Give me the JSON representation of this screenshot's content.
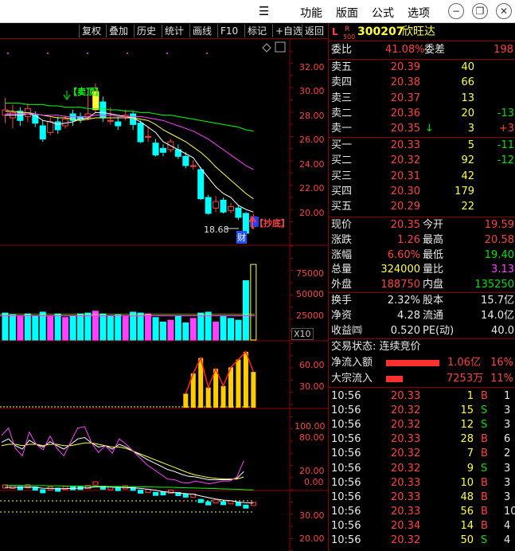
{
  "titlebar": {
    "menu_icon": "hamburger-menu-icon",
    "menus": [
      "功能",
      "版面",
      "公式",
      "选项"
    ],
    "buttons": [
      "minimize-icon",
      "restore-icon",
      "close-icon"
    ]
  },
  "toolbar": {
    "items": [
      "复权",
      "叠加",
      "历史",
      "统计",
      "画线",
      "F10",
      "标记",
      "+自选",
      "返回"
    ]
  },
  "main_chart": {
    "y_ticks": [
      "32.00",
      "30.00",
      "28.00",
      "26.00",
      "24.00",
      "22.00",
      "20.00"
    ],
    "sell_top_label": "【卖顶】",
    "buy_bottom_label": "【抄底】",
    "low_label": "18.68",
    "cai_label": "财"
  },
  "volume_chart": {
    "y_ticks": [
      "75000",
      "50000",
      "25000"
    ],
    "unit": "X10"
  },
  "indicator1": {
    "y_ticks": [
      "60.00",
      "30.00"
    ]
  },
  "indicator2": {
    "y_ticks": [
      "100.00",
      "80.00",
      "20.00",
      "0.00"
    ]
  },
  "indicator3": {
    "y_ticks": [
      "30.00",
      "20.00"
    ]
  },
  "chart_data": [
    {
      "type": "candlestick",
      "title": "",
      "ylim": [
        18.5,
        33.5
      ],
      "candles": [
        {
          "o": 28.0,
          "c": 28.4,
          "h": 29.3,
          "l": 27.4
        },
        {
          "o": 27.8,
          "c": 28.2,
          "h": 28.8,
          "l": 27.0
        },
        {
          "o": 28.3,
          "c": 27.6,
          "h": 28.6,
          "l": 27.2
        },
        {
          "o": 27.9,
          "c": 28.5,
          "h": 28.9,
          "l": 27.5
        },
        {
          "o": 28.0,
          "c": 27.4,
          "h": 28.3,
          "l": 27.1
        },
        {
          "o": 27.2,
          "c": 26.2,
          "h": 27.6,
          "l": 26.0
        },
        {
          "o": 26.7,
          "c": 27.5,
          "h": 27.8,
          "l": 26.5
        },
        {
          "o": 27.5,
          "c": 26.9,
          "h": 27.9,
          "l": 26.6
        },
        {
          "o": 27.2,
          "c": 27.7,
          "h": 28.0,
          "l": 27.0
        },
        {
          "o": 28.1,
          "c": 27.6,
          "h": 28.4,
          "l": 27.2
        },
        {
          "o": 27.9,
          "c": 27.7,
          "h": 28.2,
          "l": 27.4
        },
        {
          "o": 27.8,
          "c": 28.1,
          "h": 29.5,
          "l": 27.6
        },
        {
          "o": 28.4,
          "c": 29.8,
          "h": 30.4,
          "l": 28.2
        },
        {
          "o": 29.0,
          "c": 27.8,
          "h": 29.4,
          "l": 27.5
        },
        {
          "o": 27.6,
          "c": 27.6,
          "h": 28.6,
          "l": 27.3
        },
        {
          "o": 27.5,
          "c": 27.2,
          "h": 27.9,
          "l": 26.9
        },
        {
          "o": 27.9,
          "c": 28.0,
          "h": 28.4,
          "l": 27.6
        },
        {
          "o": 28.1,
          "c": 27.3,
          "h": 28.3,
          "l": 26.9
        },
        {
          "o": 27.4,
          "c": 26.0,
          "h": 27.6,
          "l": 25.9
        },
        {
          "o": 26.4,
          "c": 26.4,
          "h": 27.1,
          "l": 26.0
        },
        {
          "o": 25.9,
          "c": 25.0,
          "h": 26.2,
          "l": 24.9
        },
        {
          "o": 25.5,
          "c": 25.2,
          "h": 25.8,
          "l": 24.9
        },
        {
          "o": 25.4,
          "c": 26.0,
          "h": 26.2,
          "l": 25.2
        },
        {
          "o": 25.4,
          "c": 24.9,
          "h": 25.8,
          "l": 24.7
        },
        {
          "o": 24.9,
          "c": 24.2,
          "h": 25.2,
          "l": 24.0
        },
        {
          "o": 24.2,
          "c": 24.2,
          "h": 24.6,
          "l": 23.9
        },
        {
          "o": 23.9,
          "c": 21.7,
          "h": 24.1,
          "l": 21.6
        },
        {
          "o": 21.8,
          "c": 20.6,
          "h": 22.0,
          "l": 20.5
        },
        {
          "o": 21.0,
          "c": 21.5,
          "h": 21.9,
          "l": 20.7
        },
        {
          "o": 21.6,
          "c": 20.7,
          "h": 21.8,
          "l": 20.6
        },
        {
          "o": 20.8,
          "c": 21.1,
          "h": 21.4,
          "l": 20.6
        },
        {
          "o": 21.0,
          "c": 20.3,
          "h": 21.2,
          "l": 20.1
        },
        {
          "o": 20.6,
          "c": 19.1,
          "h": 20.7,
          "l": 18.7
        },
        {
          "o": 19.6,
          "c": 20.35,
          "h": 20.58,
          "l": 19.4
        }
      ],
      "ma_lines": [
        {
          "name": "MA5",
          "color": "#ffffff",
          "values": [
            28.0,
            28.0,
            28.0,
            28.1,
            28.0,
            27.6,
            27.5,
            27.3,
            27.4,
            27.5,
            27.7,
            27.8,
            28.2,
            28.2,
            28.1,
            28.0,
            27.9,
            27.8,
            27.5,
            27.1,
            26.7,
            26.0,
            25.7,
            25.4,
            25.1,
            24.8,
            24.0,
            23.3,
            22.6,
            22.1,
            21.8,
            21.2,
            20.9,
            20.7
          ]
        },
        {
          "name": "MA10",
          "color": "#ffff40",
          "values": [
            28.3,
            28.3,
            28.2,
            28.2,
            28.1,
            28.0,
            27.9,
            27.8,
            27.8,
            27.7,
            27.6,
            27.7,
            27.8,
            27.8,
            27.8,
            27.8,
            27.8,
            27.8,
            27.7,
            27.6,
            27.3,
            26.9,
            26.6,
            26.3,
            26.0,
            25.6,
            25.2,
            24.7,
            24.1,
            23.6,
            23.1,
            22.6,
            22.1,
            21.7
          ]
        },
        {
          "name": "MA20",
          "color": "#ff40ff",
          "values": [
            28.1,
            28.1,
            28.1,
            28.1,
            28.1,
            28.0,
            28.0,
            28.0,
            27.9,
            27.9,
            27.9,
            27.9,
            28.0,
            28.0,
            28.0,
            27.9,
            27.9,
            27.9,
            27.9,
            27.8,
            27.7,
            27.6,
            27.4,
            27.2,
            27.0,
            26.8,
            26.5,
            26.2,
            25.8,
            25.4,
            25.0,
            24.6,
            24.2,
            23.9
          ]
        },
        {
          "name": "MA60",
          "color": "#00ff00",
          "values": [
            28.9,
            28.9,
            28.9,
            28.8,
            28.8,
            28.8,
            28.7,
            28.7,
            28.6,
            28.6,
            28.6,
            28.5,
            28.5,
            28.5,
            28.4,
            28.4,
            28.3,
            28.3,
            28.2,
            28.2,
            28.1,
            28.0,
            28.0,
            27.9,
            27.8,
            27.7,
            27.6,
            27.5,
            27.4,
            27.3,
            27.2,
            27.1,
            26.9,
            26.8
          ]
        }
      ]
    },
    {
      "type": "bar",
      "title": "",
      "ylabel": "",
      "ylim": [
        0,
        100000
      ],
      "values": [
        30000,
        28000,
        26000,
        29000,
        27000,
        31000,
        26000,
        29000,
        25000,
        27000,
        29000,
        30000,
        32000,
        29000,
        27000,
        28000,
        26000,
        31000,
        30000,
        29000,
        25000,
        20000,
        22000,
        27000,
        19000,
        24000,
        30000,
        31000,
        20000,
        26000,
        24000,
        22000,
        66000,
        84000
      ],
      "bar_colors": [
        "#00ffff",
        "#00ffff",
        "#ff40ff",
        "#00ffff",
        "#00ffff",
        "#00ffff",
        "#ff40ff",
        "#00ffff",
        "#ff40ff",
        "#00ffff",
        "#00ffff",
        "#00ffff",
        "#ff40ff",
        "#00ffff",
        "#00ffff",
        "#00ffff",
        "#ff40ff",
        "#00ffff",
        "#00ffff",
        "#ff40ff",
        "#00ffff",
        "#00ffff",
        "#ff40ff",
        "#00ffff",
        "#00ffff",
        "#ff40ff",
        "#00ffff",
        "#00ffff",
        "#ff40ff",
        "#00ffff",
        "#00ffff",
        "#00ffff",
        "#00ffff",
        "#ffff40"
      ]
    },
    {
      "type": "bar",
      "title": "",
      "ylim": [
        0,
        80
      ],
      "values": [
        0,
        0,
        0,
        0,
        0,
        0,
        0,
        0,
        0,
        0,
        0,
        0,
        0,
        0,
        0,
        0,
        0,
        0,
        0,
        0,
        0,
        0,
        0,
        0,
        0,
        0,
        0,
        18,
        44,
        64,
        26,
        50,
        28,
        52,
        62,
        72,
        46
      ]
    },
    {
      "type": "line",
      "title": "",
      "ylim": [
        0,
        110
      ],
      "series": [
        {
          "name": "K",
          "color": "#ffffff",
          "values": [
            65,
            70,
            60,
            55,
            68,
            62,
            58,
            66,
            60,
            55,
            62,
            70,
            72,
            64,
            58,
            60,
            55,
            62,
            58,
            52,
            46,
            40,
            35,
            30,
            25,
            22,
            18,
            15,
            14,
            12,
            10,
            10,
            10,
            10,
            12,
            22
          ]
        },
        {
          "name": "D",
          "color": "#ffff40",
          "values": [
            60,
            62,
            62,
            60,
            62,
            62,
            60,
            62,
            62,
            60,
            60,
            62,
            64,
            64,
            62,
            60,
            58,
            58,
            56,
            52,
            48,
            44,
            40,
            36,
            32,
            28,
            24,
            20,
            17,
            15,
            13,
            12,
            11,
            11,
            11,
            14
          ]
        },
        {
          "name": "J",
          "color": "#ff40ff",
          "values": [
            75,
            86,
            56,
            45,
            80,
            62,
            54,
            74,
            56,
            45,
            66,
            86,
            88,
            64,
            50,
            60,
            49,
            70,
            62,
            52,
            42,
            32,
            25,
            18,
            11,
            10,
            6,
            5,
            8,
            6,
            4,
            6,
            8,
            8,
            14,
            38
          ]
        }
      ]
    },
    {
      "type": "line",
      "title": "",
      "ylim": [
        10,
        35
      ],
      "series": [
        {
          "name": "MA1",
          "color": "#ffffff",
          "values": [
            28.0,
            28.0,
            28.0,
            28.1,
            28.0,
            27.6,
            27.5,
            27.3,
            27.4,
            27.5,
            27.7,
            27.8,
            28.2,
            28.2,
            28.1,
            28.0,
            27.9,
            27.8,
            27.5,
            27.1,
            26.7,
            26.0,
            25.7,
            25.4,
            25.1,
            24.8,
            24.0,
            23.3,
            22.6,
            22.1,
            21.8,
            21.2,
            20.9,
            20.7
          ]
        },
        {
          "name": "MA2",
          "color": "#00ff00",
          "values": [
            28.9,
            28.9,
            28.9,
            28.8,
            28.8,
            28.8,
            28.7,
            28.7,
            28.6,
            28.6,
            28.6,
            28.5,
            28.5,
            28.5,
            28.4,
            28.4,
            28.3,
            28.3,
            28.2,
            28.2,
            28.1,
            28.0,
            28.0,
            27.9,
            27.8,
            27.7,
            27.6,
            27.5,
            27.4,
            27.3,
            27.2,
            27.1,
            26.9,
            26.8
          ]
        }
      ]
    }
  ],
  "quote": {
    "header": {
      "L": "L",
      "R": "R",
      "num500": "500",
      "code": "300207",
      "name": "欣旺达"
    },
    "weibi": {
      "label": "委比",
      "value": "41.08%",
      "label2": "委差",
      "value2": "198"
    },
    "asks": [
      {
        "label": "卖五",
        "price": "20.39",
        "vol": "40",
        "chg": ""
      },
      {
        "label": "卖四",
        "price": "20.38",
        "vol": "66",
        "chg": ""
      },
      {
        "label": "卖三",
        "price": "20.37",
        "vol": "13",
        "chg": ""
      },
      {
        "label": "卖二",
        "price": "20.36",
        "vol": "20",
        "chg": "-13"
      },
      {
        "label": "卖一",
        "price": "20.35",
        "vol": "3",
        "chg": "+3",
        "arrow": "↓"
      }
    ],
    "bids": [
      {
        "label": "买一",
        "price": "20.33",
        "vol": "5",
        "chg": "-11"
      },
      {
        "label": "买二",
        "price": "20.32",
        "vol": "92",
        "chg": "-12"
      },
      {
        "label": "买三",
        "price": "20.31",
        "vol": "42",
        "chg": ""
      },
      {
        "label": "买四",
        "price": "20.30",
        "vol": "179",
        "chg": ""
      },
      {
        "label": "买五",
        "price": "20.29",
        "vol": "22",
        "chg": ""
      }
    ],
    "stats": [
      {
        "l1": "现价",
        "v1": "20.35",
        "l2": "今开",
        "v2": "19.59",
        "c1": "red",
        "c2": "red"
      },
      {
        "l1": "涨跌",
        "v1": "1.26",
        "l2": "最高",
        "v2": "20.58",
        "c1": "red",
        "c2": "red"
      },
      {
        "l1": "涨幅",
        "v1": "6.60%",
        "l2": "最低",
        "v2": "19.40",
        "c1": "red",
        "c2": "grn"
      },
      {
        "l1": "总量",
        "v1": "324000",
        "l2": "量比",
        "v2": "3.13",
        "c1": "yel",
        "c2": "mag"
      },
      {
        "l1": "外盘",
        "v1": "188750",
        "l2": "内盘",
        "v2": "135250",
        "c1": "red",
        "c2": "grn"
      }
    ],
    "fundamentals": [
      {
        "l1": "换手",
        "v1": "2.32%",
        "l2": "股本",
        "v2": "15.7亿"
      },
      {
        "l1": "净资",
        "v1": "4.28",
        "l2": "流通",
        "v2": "14.0亿"
      },
      {
        "l1": "收益㈣",
        "v1": "0.520",
        "l2": "PE(动)",
        "v2": "40.0"
      }
    ],
    "trade_state": "交易状态: 连续竞价",
    "net_inflow": {
      "label": "净流入额",
      "value": "1.06亿",
      "pct": "16%",
      "bar_fraction": 0.95
    },
    "block_inflow": {
      "label": "大宗流入",
      "value": "7253万",
      "pct": "11%",
      "bar_fraction": 0.3
    },
    "ticks": [
      {
        "time": "10:56",
        "price": "20.33",
        "vol": "1",
        "side": "B",
        "n": "1"
      },
      {
        "time": "10:56",
        "price": "20.32",
        "vol": "15",
        "side": "S",
        "n": "3"
      },
      {
        "time": "10:56",
        "price": "20.32",
        "vol": "12",
        "side": "S",
        "n": "3"
      },
      {
        "time": "10:56",
        "price": "20.33",
        "vol": "28",
        "side": "B",
        "n": "6"
      },
      {
        "time": "10:56",
        "price": "20.32",
        "vol": "7",
        "side": "B",
        "n": "2"
      },
      {
        "time": "10:56",
        "price": "20.32",
        "vol": "9",
        "side": "S",
        "n": "3"
      },
      {
        "time": "10:56",
        "price": "20.33",
        "vol": "10",
        "side": "B",
        "n": "3"
      },
      {
        "time": "10:56",
        "price": "20.33",
        "vol": "48",
        "side": "B",
        "n": "3"
      },
      {
        "time": "10:56",
        "price": "20.33",
        "vol": "56",
        "side": "B",
        "n": "10"
      },
      {
        "time": "10:56",
        "price": "20.34",
        "vol": "14",
        "side": "B",
        "n": "4"
      },
      {
        "time": "10:56",
        "price": "20.32",
        "vol": "50",
        "side": "S",
        "n": "4"
      }
    ]
  }
}
